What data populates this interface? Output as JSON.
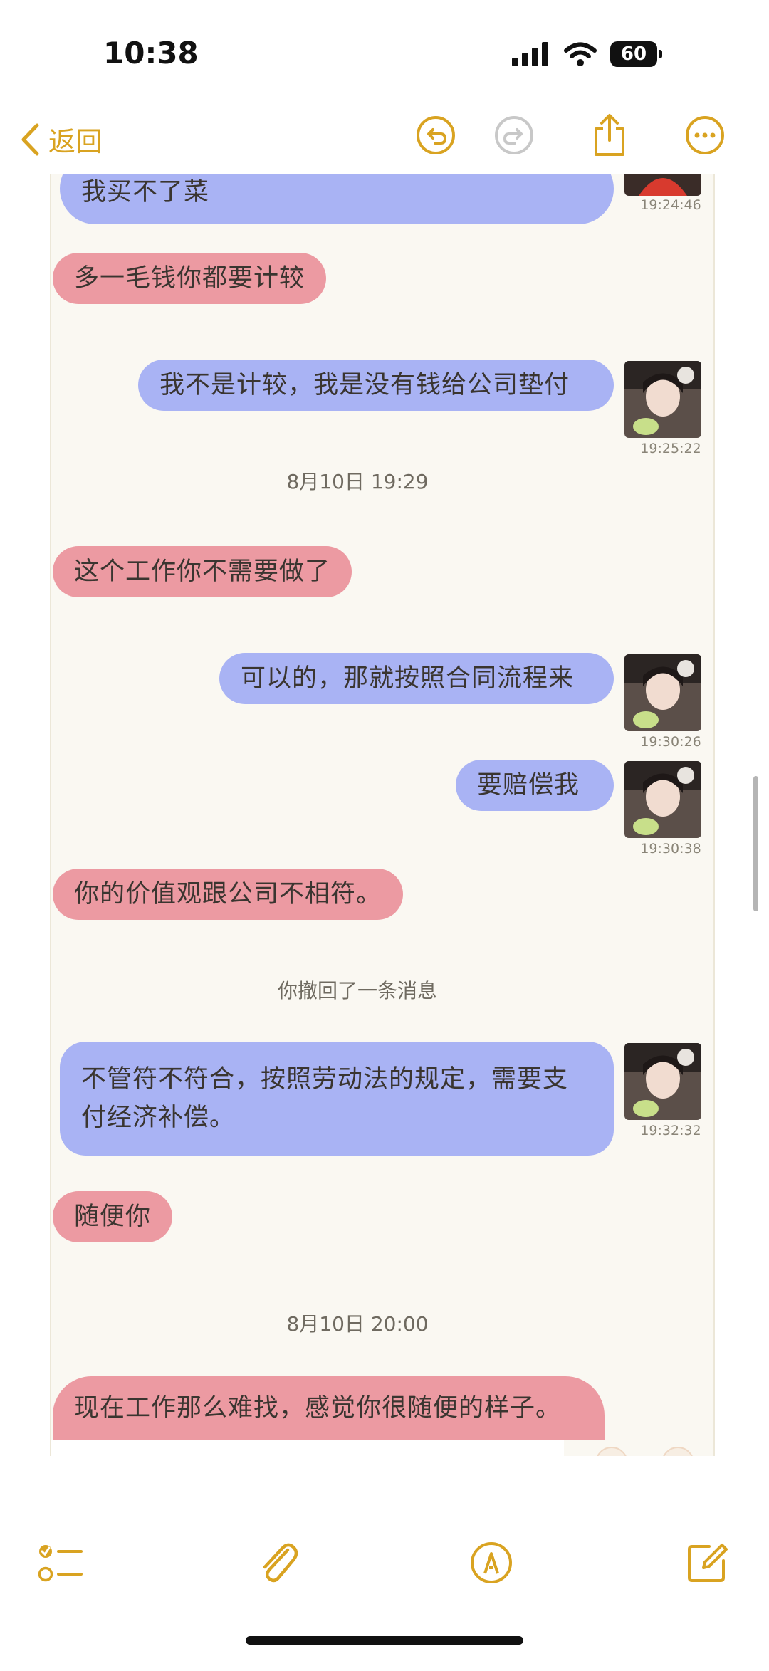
{
  "status_bar": {
    "time": "10:38",
    "battery": "60"
  },
  "nav": {
    "back_label": "返回"
  },
  "chat": {
    "partial_top": {
      "text": "我买不了菜",
      "time": "19:24:46"
    },
    "messages": [
      {
        "id": "m1",
        "side": "left",
        "text": "多一毛钱你都要计较"
      },
      {
        "id": "m2",
        "side": "right",
        "text": "我不是计较，我是没有钱给公司垫付",
        "time": "19:25:22"
      },
      {
        "id": "m3",
        "side": "left",
        "text": "这个工作你不需要做了"
      },
      {
        "id": "m4",
        "side": "right",
        "text": "可以的，那就按照合同流程来",
        "time": "19:30:26"
      },
      {
        "id": "m5",
        "side": "right",
        "text": "要赔偿我",
        "time": "19:30:38"
      },
      {
        "id": "m6",
        "side": "left",
        "text": "你的价值观跟公司不相符。"
      },
      {
        "id": "m7",
        "side": "right",
        "line1": "不管符不符合，按照劳动法的规定，需要支",
        "line2": "付经济补偿。",
        "time": "19:32:32"
      },
      {
        "id": "m8",
        "side": "left",
        "text": "随便你"
      },
      {
        "id": "m9",
        "side": "left",
        "text": "现在工作那么难找，感觉你很随便的样子。"
      }
    ],
    "dividers": {
      "d1": "8月10日  19:29",
      "d2": "8月10日  20:00"
    },
    "recall_notice": "你撤回了一条消息"
  },
  "colors": {
    "accent": "#d9a321",
    "bubble_self": "#a9b3f4",
    "bubble_other": "#ec9aa2",
    "panel_bg": "#faf8f2"
  },
  "icons": {
    "nav": [
      "chevron-left-icon",
      "undo-icon",
      "redo-icon",
      "share-icon",
      "more-icon"
    ],
    "toolbar": [
      "checklist-icon",
      "paperclip-icon",
      "pen-markup-icon",
      "compose-icon"
    ]
  }
}
